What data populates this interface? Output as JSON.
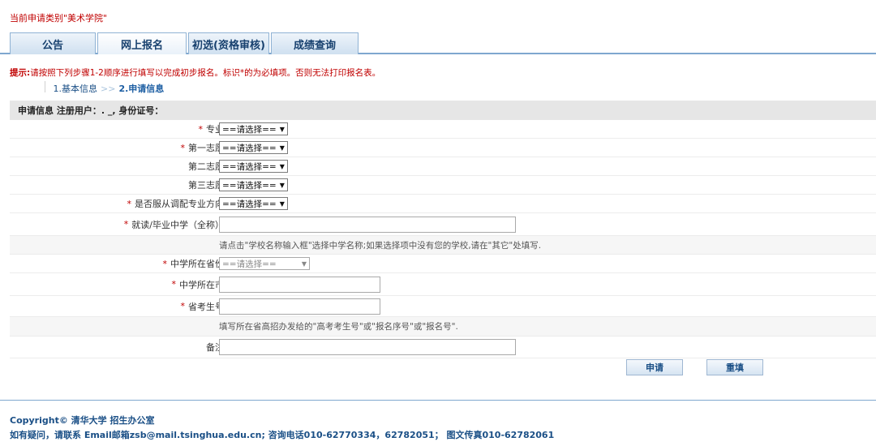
{
  "header": {
    "category_text": "当前申请类别\"美术学院\""
  },
  "tabs": [
    {
      "label": "公告"
    },
    {
      "label": "网上报名"
    },
    {
      "label": "初选(资格审核)"
    },
    {
      "label": "成绩查询"
    }
  ],
  "tip": {
    "prefix": "提示:",
    "text": "请按照下列步骤1-2顺序进行填写以完成初步报名。标识*的为必填项。否则无法打印报名表。"
  },
  "steps": {
    "step1": "1.基本信息",
    "separator": ">>",
    "step2": "2.申请信息"
  },
  "section": {
    "title": "申请信息  注册用户：. _, 身份证号："
  },
  "form": {
    "major": {
      "label": "专业",
      "value": "==请选择=="
    },
    "choice1": {
      "label": "第一志愿",
      "value": "==请选择=="
    },
    "choice2": {
      "label": "第二志愿",
      "value": "==请选择=="
    },
    "choice3": {
      "label": "第三志愿",
      "value": "==请选择=="
    },
    "adjust": {
      "label": "是否服从调配专业方向",
      "value": "==请选择=="
    },
    "school": {
      "label": "就读/毕业中学（全称）",
      "value": ""
    },
    "school_hint": "请点击\"学校名称输入框\"选择中学名称;如果选择项中没有您的学校,请在\"其它\"处填写.",
    "province": {
      "label": "中学所在省份",
      "value": "==请选择=="
    },
    "city": {
      "label": "中学所在市",
      "value": ""
    },
    "exam_no": {
      "label": "省考生号",
      "value": ""
    },
    "exam_hint": "填写所在省高招办发给的\"高考考生号\"或\"报名序号\"或\"报名号\".",
    "remark": {
      "label": "备注",
      "value": ""
    },
    "required_mark": "*"
  },
  "buttons": {
    "submit": "申请",
    "reset": "重填"
  },
  "footer": {
    "line1": "Copyright© 清华大学 招生办公室",
    "line2": "如有疑问，请联系 Email邮箱zsb@mail.tsinghua.edu.cn; 咨询电话010-62770334，62782051； 图文传真010-62782061"
  }
}
